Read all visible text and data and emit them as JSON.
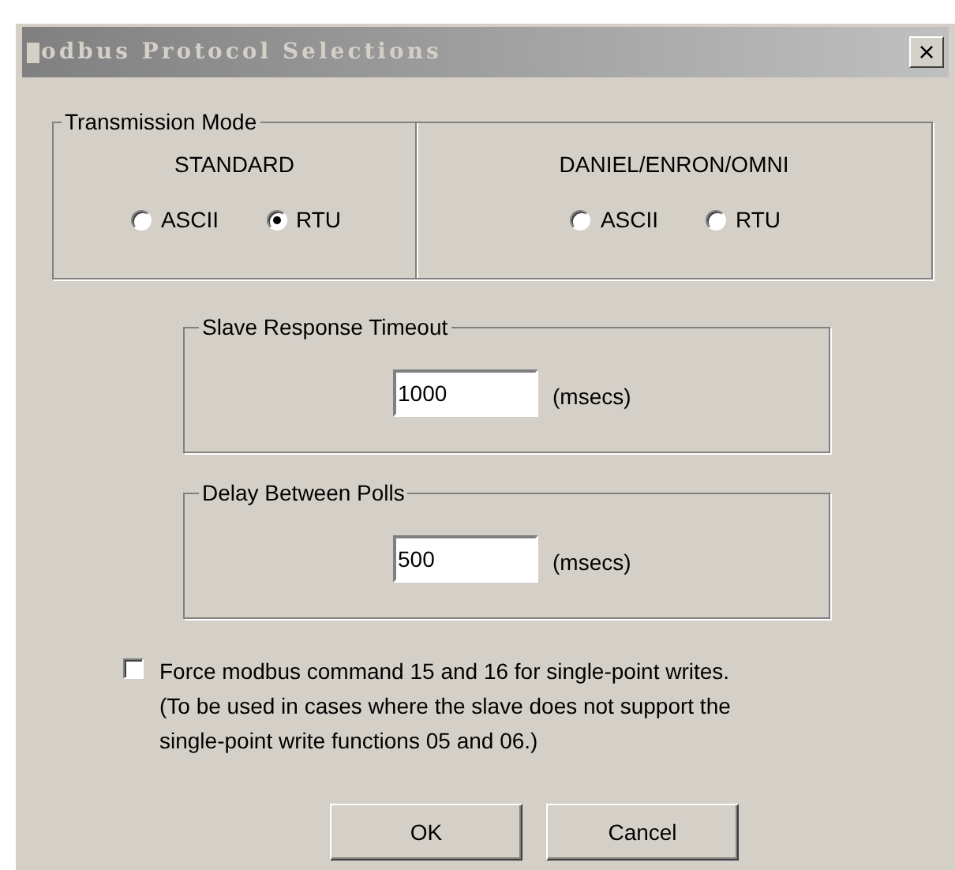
{
  "window": {
    "title": "odbus Protocol Selections",
    "close": "×"
  },
  "transmission_mode": {
    "label": "Transmission Mode",
    "groups": [
      {
        "heading": "STANDARD",
        "options": [
          {
            "label": "ASCII",
            "selected": false
          },
          {
            "label": "RTU",
            "selected": true
          }
        ]
      },
      {
        "heading": "DANIEL/ENRON/OMNI",
        "options": [
          {
            "label": "ASCII",
            "selected": false
          },
          {
            "label": "RTU",
            "selected": false
          }
        ]
      }
    ]
  },
  "timeouts": [
    {
      "label": "Slave Response Timeout",
      "value": "1000",
      "unit": "(msecs)"
    },
    {
      "label": "Delay Between Polls",
      "value": "500",
      "unit": "(msecs)"
    }
  ],
  "force_option": {
    "checked": false,
    "lines": [
      "Force modbus command 15 and 16 for single-point writes.",
      "(To be used in cases where the slave does not support the",
      "single-point write functions 05 and 06.)"
    ]
  },
  "buttons": [
    "OK",
    "Cancel"
  ]
}
